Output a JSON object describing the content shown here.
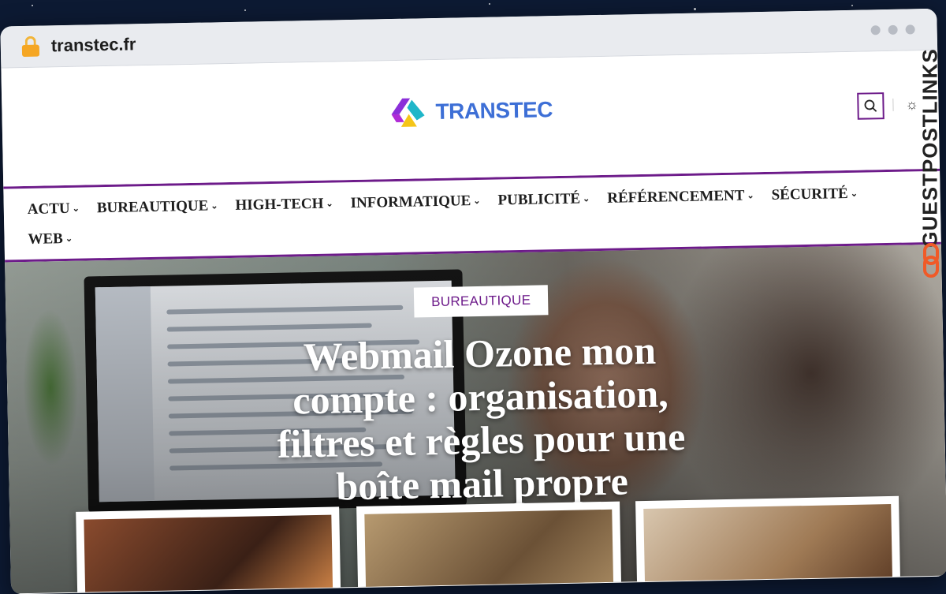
{
  "browser": {
    "url": "transtec.fr"
  },
  "site": {
    "logo_text": "TRANSTEC",
    "colors": {
      "accent": "#6d1b8a",
      "logo_blue": "#3d6fd6",
      "logo_yellow": "#f5c518",
      "logo_purple": "#8b2fd9",
      "logo_teal": "#1fb6c9"
    }
  },
  "header": {
    "search_icon": "search-icon",
    "theme_icon": "sun-icon"
  },
  "nav": {
    "items": [
      {
        "label": "ACTU"
      },
      {
        "label": "BUREAUTIQUE"
      },
      {
        "label": "HIGH-TECH"
      },
      {
        "label": "INFORMATIQUE"
      },
      {
        "label": "PUBLICITÉ"
      },
      {
        "label": "RÉFÉRENCEMENT"
      },
      {
        "label": "SÉCURITÉ"
      },
      {
        "label": "WEB"
      }
    ],
    "chevron": "⌄"
  },
  "hero": {
    "category": "BUREAUTIQUE",
    "title": "Webmail Ozone mon compte : organisation, filtres et règles pour une boîte mail propre"
  },
  "watermark": {
    "text": "GUESTPOSTLINKS",
    "icon": "link-icon"
  }
}
